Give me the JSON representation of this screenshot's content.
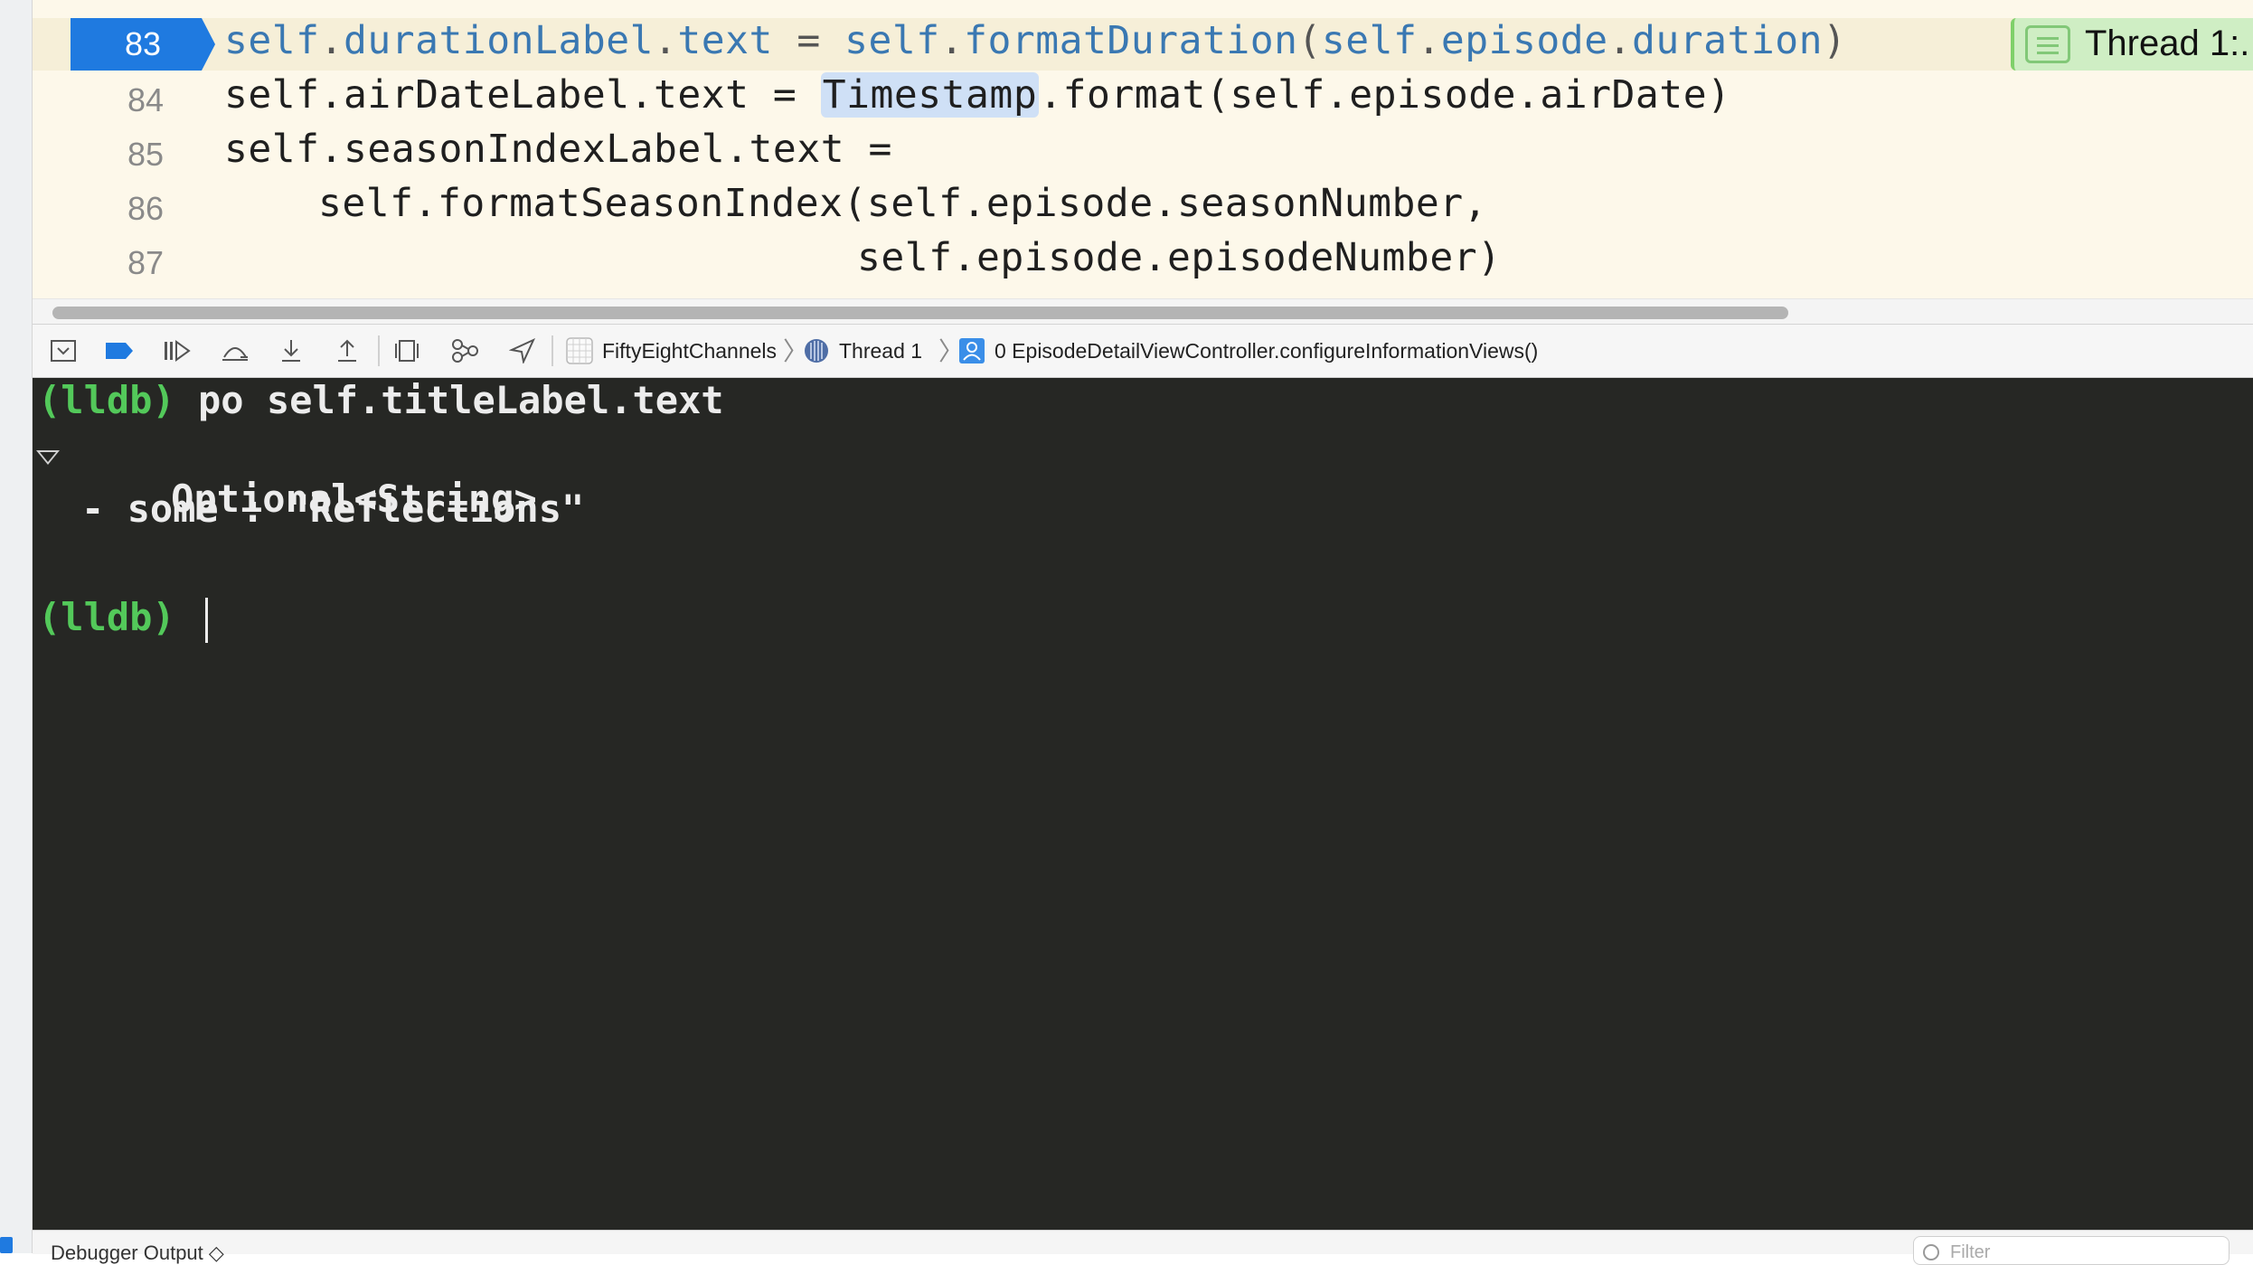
{
  "editor": {
    "lines": [
      {
        "number": "83",
        "current": true
      },
      {
        "number": "84"
      },
      {
        "number": "85"
      },
      {
        "number": "86"
      },
      {
        "number": "87"
      }
    ],
    "code": {
      "l83": [
        "self",
        ".",
        "durationLabel",
        ".",
        "text",
        " = ",
        "self",
        ".",
        "formatDuration",
        "(",
        "self",
        ".",
        "episode",
        ".",
        "duration",
        ")"
      ],
      "l84_a": "self.airDateLabel.text = ",
      "l84_word": "Timestamp",
      "l84_b": ".format(self.episode.airDate)",
      "l85": "self.seasonIndexLabel.text =",
      "l86": "self.formatSeasonIndex(self.episode.seasonNumber,",
      "l87": "self.episode.episodeNumber)"
    },
    "thread_annotation": "Thread 1:..."
  },
  "debug_bar": {
    "breadcrumbs": {
      "app": "FiftyEightChannels",
      "thread": "Thread 1",
      "frame": "0 EpisodeDetailViewController.configureInformationViews()"
    }
  },
  "console": {
    "prompt": "(lldb)",
    "command": "po self.titleLabel.text",
    "result_type": "Optional<String>",
    "result_value": "- some : \"Reflections\""
  },
  "bottom_bar": {
    "output_selector": "Debugger Output ◇",
    "filter_placeholder": "Filter"
  },
  "colors": {
    "editor_bg": "#fdf8ea",
    "console_bg": "#262724",
    "prompt_green": "#53c95a",
    "pc_blue": "#1f7ae0",
    "keyword_blue": "#3a78b2"
  }
}
